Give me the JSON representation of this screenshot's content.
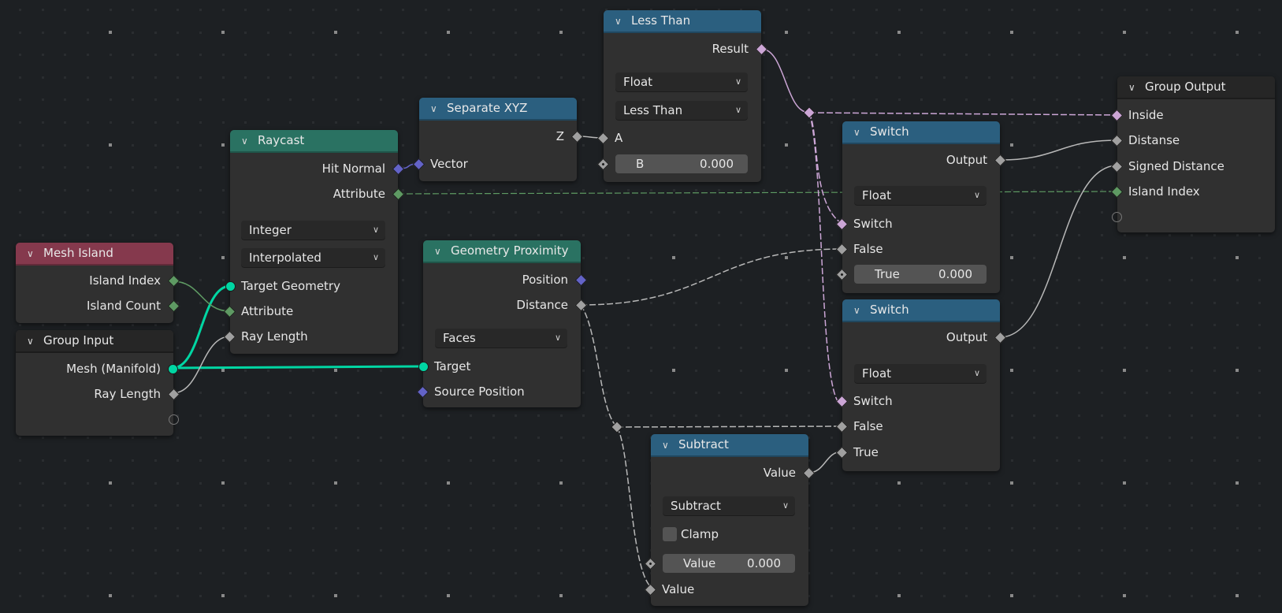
{
  "editor": "Geometry Node Editor",
  "colors": {
    "background": "#1d2023",
    "node_body": "#303030",
    "header_blue": "#2b5f7f",
    "header_green": "#2a7262",
    "header_red": "#85394d",
    "header_dark": "#262626",
    "socket_float": "#a0a0a0",
    "socket_bool": "#cca6d6",
    "socket_int": "#5e9a63",
    "socket_vector": "#6363c7",
    "socket_geometry": "#00d6a3"
  },
  "icons": {
    "collapse": "chevron-down-icon",
    "dropdown": "chevron-down-icon"
  },
  "nodes": {
    "mesh_island": {
      "title": "Mesh Island",
      "outputs": [
        "Island Index",
        "Island Count"
      ]
    },
    "group_input": {
      "title": "Group Input",
      "outputs": [
        "Mesh (Manifold)",
        "Ray Length"
      ]
    },
    "raycast": {
      "title": "Raycast",
      "outputs": [
        "Hit Normal",
        "Attribute"
      ],
      "data_type": "Integer",
      "mapping": "Interpolated",
      "inputs": [
        "Target Geometry",
        "Attribute",
        "Ray Length"
      ]
    },
    "separate_xyz": {
      "title": "Separate XYZ",
      "outputs": [
        "Z"
      ],
      "inputs": [
        "Vector"
      ]
    },
    "less_than": {
      "title": "Less Than",
      "outputs": [
        "Result"
      ],
      "data_type": "Float",
      "operation": "Less Than",
      "input_a": "A",
      "input_b_label": "B",
      "input_b_value": "0.000"
    },
    "geometry_proximity": {
      "title": "Geometry Proximity",
      "outputs": [
        "Position",
        "Distance"
      ],
      "target_element": "Faces",
      "inputs": [
        "Target",
        "Source Position"
      ]
    },
    "switch_1": {
      "title": "Switch",
      "outputs": [
        "Output"
      ],
      "input_type": "Float",
      "inputs": [
        "Switch",
        "False"
      ],
      "true_label": "True",
      "true_value": "0.000"
    },
    "switch_2": {
      "title": "Switch",
      "outputs": [
        "Output"
      ],
      "input_type": "Float",
      "inputs": [
        "Switch",
        "False",
        "True"
      ]
    },
    "subtract": {
      "title": "Subtract",
      "outputs": [
        "Value"
      ],
      "operation": "Subtract",
      "clamp_label": "Clamp",
      "clamp_checked": false,
      "value_label": "Value",
      "value_value": "0.000",
      "input_value": "Value"
    },
    "group_output": {
      "title": "Group Output",
      "inputs": [
        "Inside",
        "Distanse",
        "Signed Distance",
        "Island Index"
      ]
    }
  }
}
